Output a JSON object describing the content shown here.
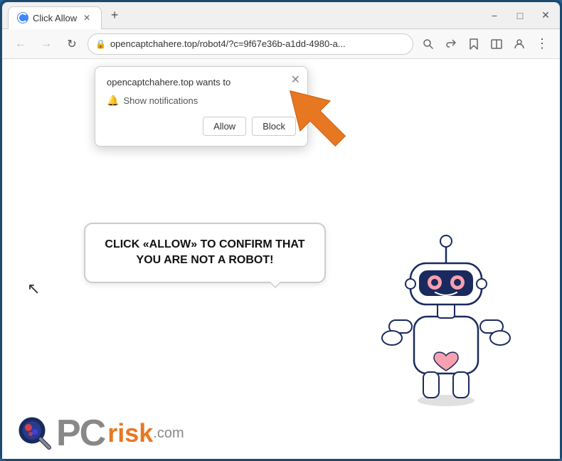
{
  "window": {
    "title": "Click Allow",
    "favicon": "globe-icon",
    "controls": {
      "minimize": "−",
      "maximize": "□",
      "close": "✕"
    }
  },
  "tab": {
    "title": "Click Allow",
    "close": "✕",
    "new_tab": "+"
  },
  "address_bar": {
    "url": "opencaptchahere.top/robot4/?c=9f67e36b-a1dd-4980-a...",
    "lock_icon": "🔒",
    "back": "←",
    "forward": "→",
    "refresh": "↻"
  },
  "notification_popup": {
    "site_text": "opencaptchahere.top wants to",
    "permission_text": "Show notifications",
    "allow_label": "Allow",
    "block_label": "Block",
    "close": "✕"
  },
  "speech_bubble": {
    "text": "CLICK «ALLOW» TO CONFIRM THAT YOU ARE NOT A ROBOT!"
  },
  "logo": {
    "pc_text": "PC",
    "risk_text": "risk",
    "com_text": ".com"
  }
}
